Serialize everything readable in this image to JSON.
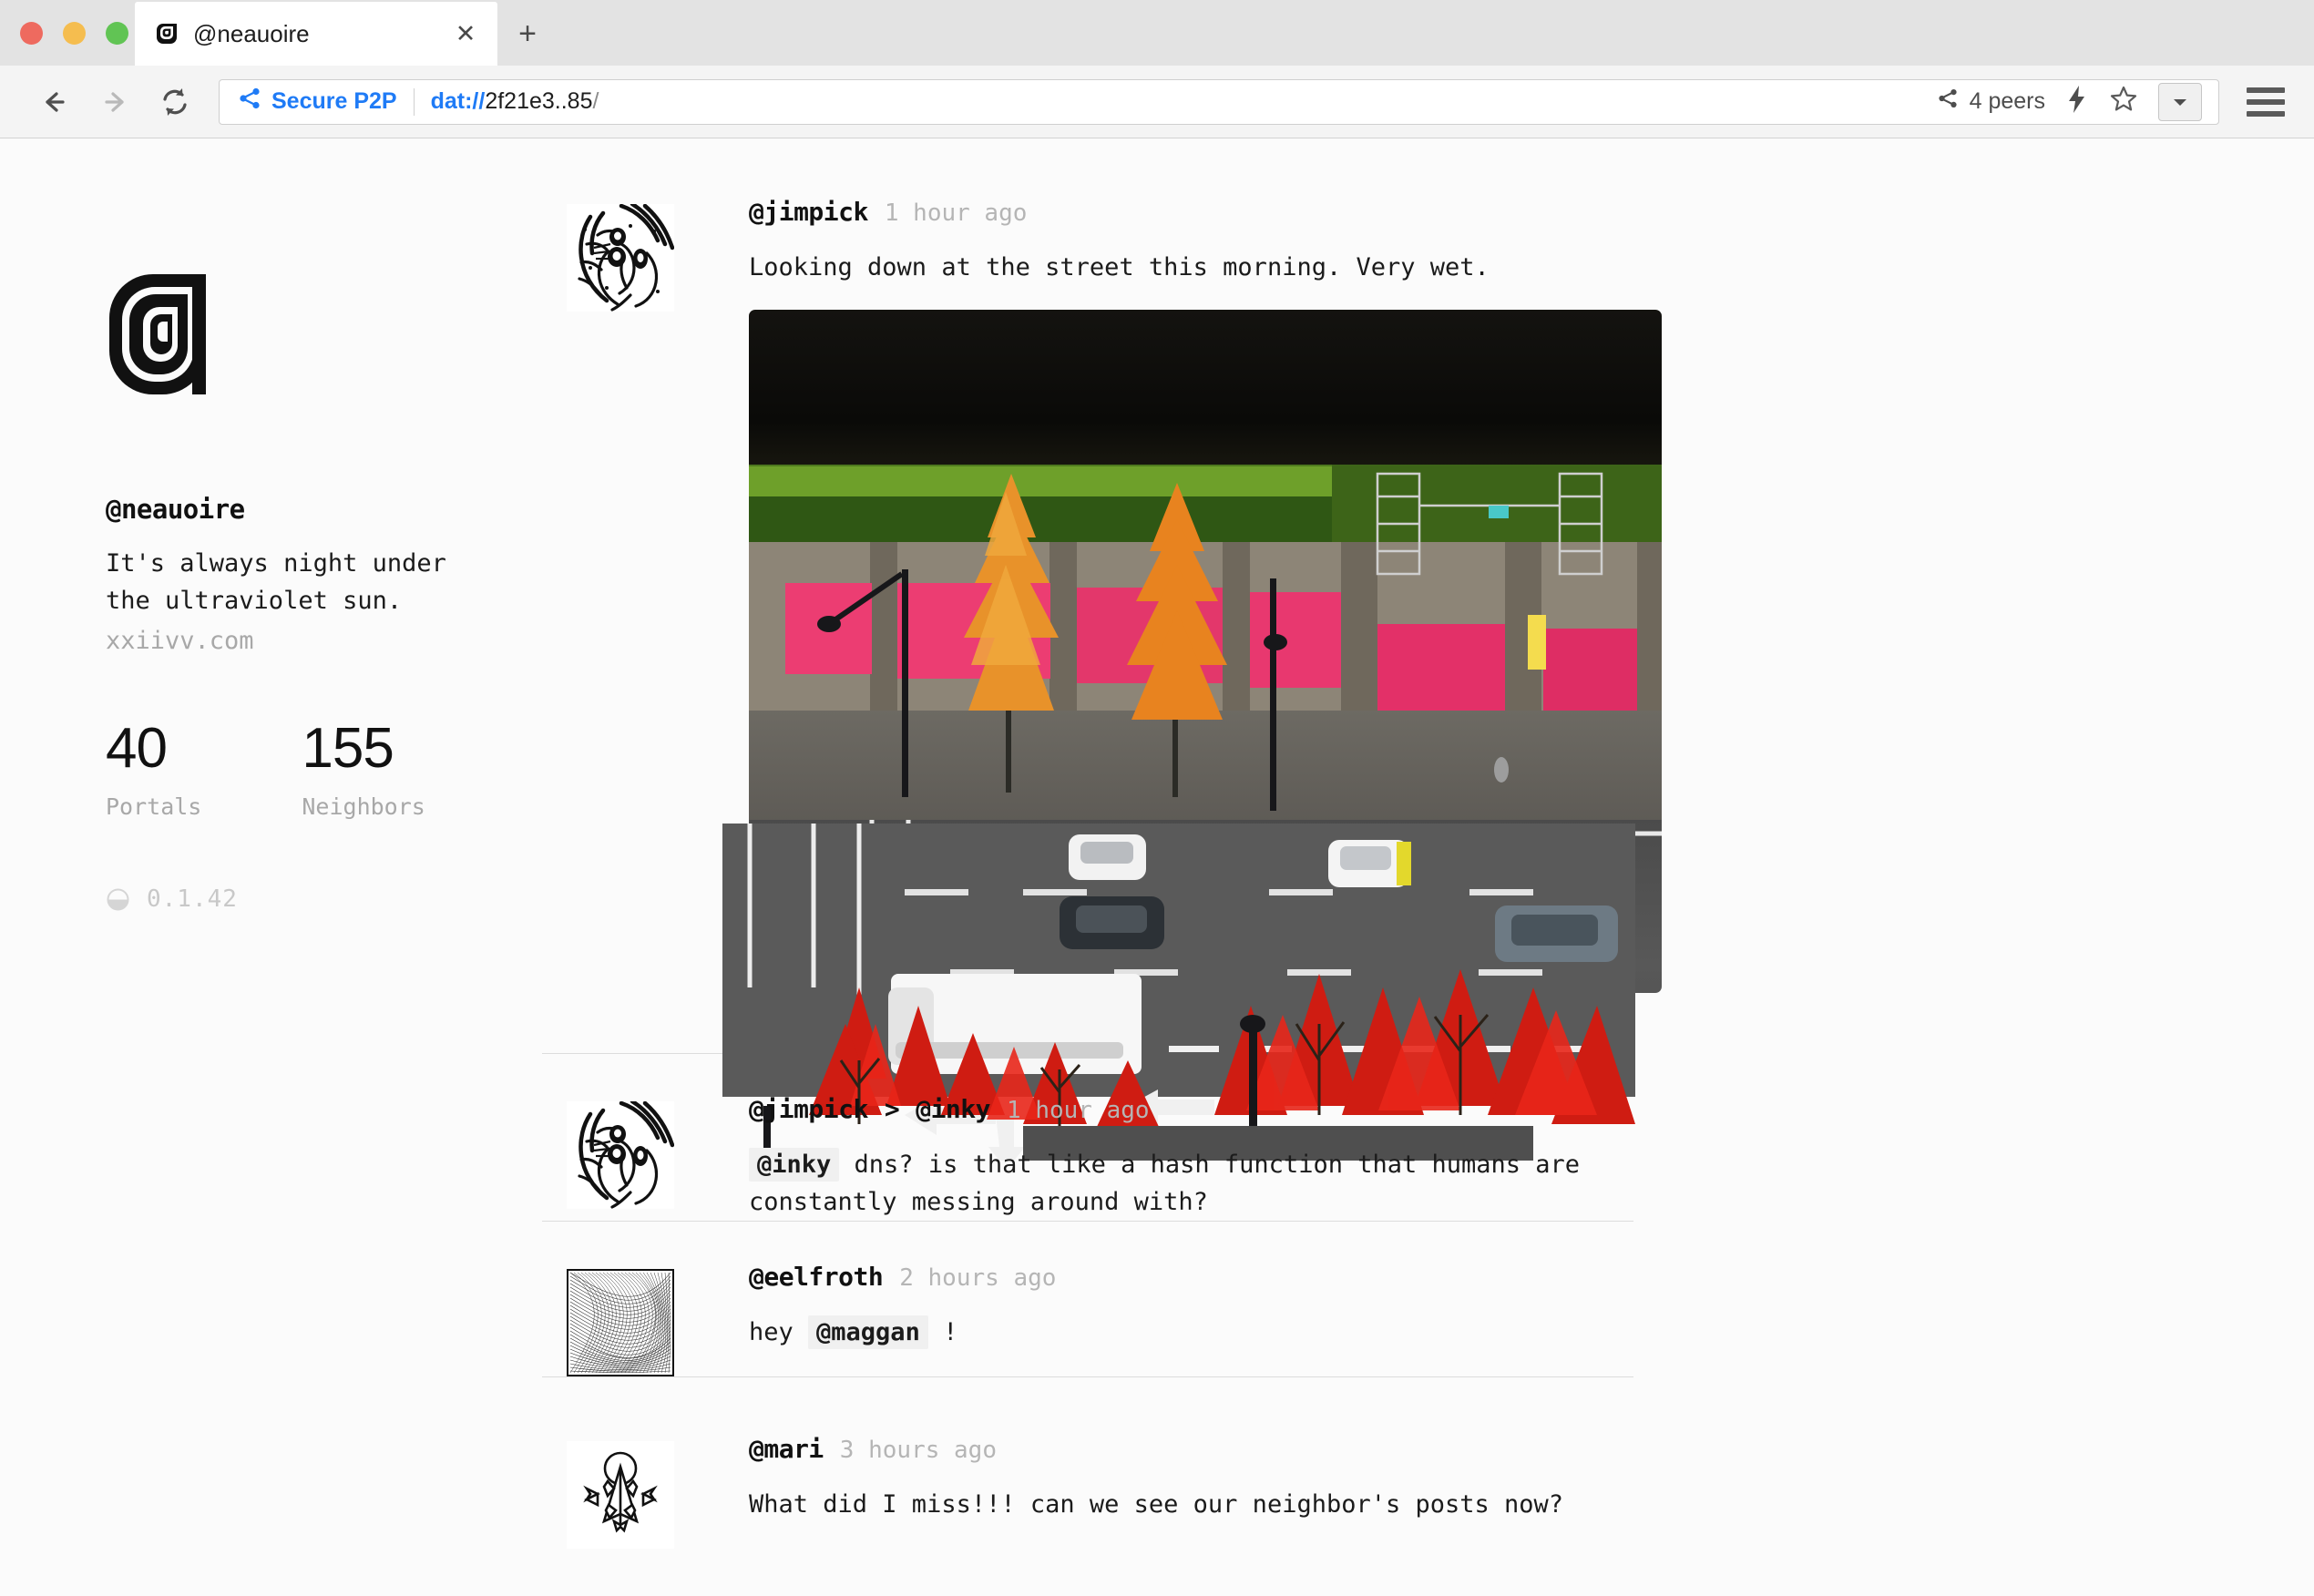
{
  "browser": {
    "window_controls": [
      "close",
      "minimize",
      "maximize"
    ],
    "tab": {
      "title": "@neauoire",
      "favicon": "rotonde-spiral-icon",
      "close_label": "✕"
    },
    "new_tab_label": "+",
    "nav": {
      "back": "back-arrow",
      "forward": "forward-arrow",
      "reload": "reload-icon"
    },
    "address": {
      "security_label": "Secure P2P",
      "security_icon": "share-p2p-icon",
      "scheme": "dat://",
      "host": "2f21e3..85",
      "path": "/",
      "peers_label": "4 peers",
      "peers_icon": "share-p2p-icon",
      "bolt_icon": "lightning-icon",
      "star_icon": "star-outline-icon",
      "dropdown_icon": "chevron-down-icon"
    },
    "menu_icon": "hamburger-menu-icon",
    "accent_color": "#1f7bf6"
  },
  "sidebar": {
    "logo_name": "rotonde-spiral-logo",
    "handle": "@neauoire",
    "bio": "It's always night under the ultraviolet sun.",
    "site": "xxiivv.com",
    "stats": [
      {
        "value": "40",
        "label": "Portals"
      },
      {
        "value": "155",
        "label": "Neighbors"
      }
    ],
    "version": {
      "icon": "half-moon-icon",
      "text": "0.1.42"
    }
  },
  "feed": {
    "posts": [
      {
        "author": "@jimpick",
        "target": null,
        "time": "1 hour ago",
        "avatar": "ink-sketch-avatar",
        "text": "Looking down at the street this morning. Very wet.",
        "media": {
          "type": "photo",
          "alt": "aerial view of a wet city street with autumn trees, pink storefront awnings, cars and a white truck"
        }
      },
      {
        "author": "@jimpick",
        "target": "@inky",
        "time": "1 hour ago",
        "avatar": "ink-sketch-avatar",
        "mention": "@inky",
        "text": " dns? is that like a hash function that humans are constantly messing around with?",
        "media": null
      },
      {
        "author": "@eelfroth",
        "target": null,
        "time": "2 hours ago",
        "avatar": "moire-lines-avatar",
        "text_before": "hey ",
        "mention": "@maggan",
        "text_after": " !",
        "media": null
      },
      {
        "author": "@mari",
        "target": null,
        "time": "3 hours ago",
        "avatar": "arrow-crest-avatar",
        "text": "What did I miss!!! can we see our neighbor's posts now?",
        "media": null
      }
    ],
    "separator_symbol": ">"
  },
  "colors": {
    "page_bg": "#fbfbfb",
    "chrome_bg": "#e3e3e3",
    "navbar_bg": "#f4f4f4",
    "divider": "#dcdcdc",
    "muted_text": "#b5b5b5",
    "mention_bg": "#f0f0f0"
  }
}
